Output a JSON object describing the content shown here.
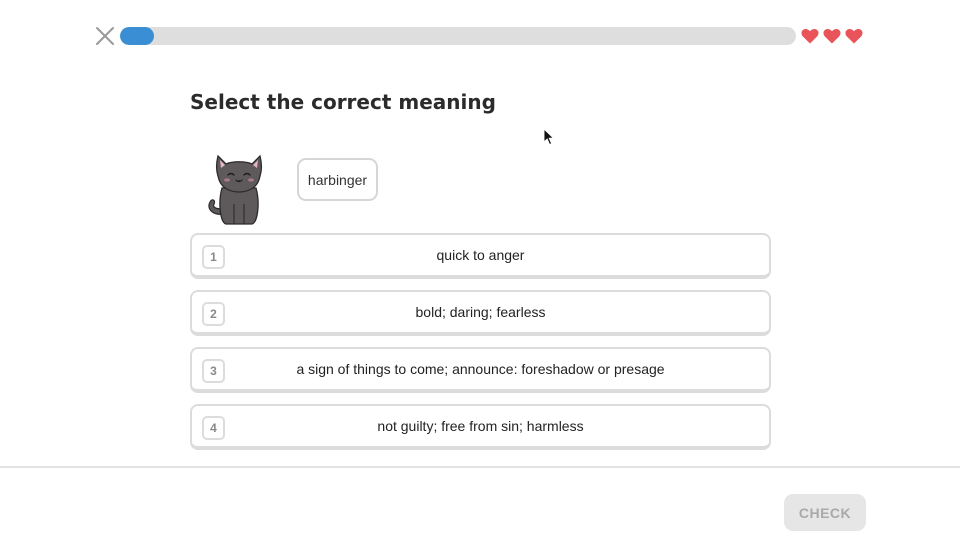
{
  "header": {
    "close_icon": "close-icon",
    "progress": 0.05,
    "progress_color": "#3a8fd4",
    "hearts": {
      "count": 3,
      "icon": "heart-icon",
      "color": "#e8545a"
    }
  },
  "question": {
    "title": "Select the correct meaning",
    "mascot": "cat-mascot",
    "word": "harbinger"
  },
  "choices": [
    {
      "number": "1",
      "text": "quick to anger"
    },
    {
      "number": "2",
      "text": "bold; daring; fearless"
    },
    {
      "number": "3",
      "text": "a sign of things to come; announce: foreshadow or presage"
    },
    {
      "number": "4",
      "text": "not guilty; free from sin; harmless"
    }
  ],
  "footer": {
    "check_label": "CHECK",
    "check_enabled": false
  }
}
